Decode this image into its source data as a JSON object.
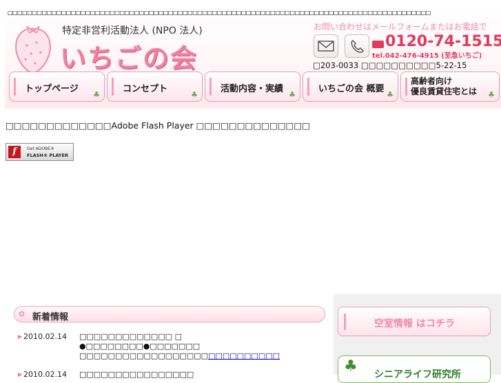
{
  "header": {
    "top_text": "□□□□□□□□□□□□□□□□□□□□□□□□□□□□□□□□□□□□□□□□□□□□□□□□□□□□□□□□□□□□□□□□□□□□□□□□□□□□□□□□□□□□□□□",
    "org_type": "特定非営利活動法人 (NPO 法人)",
    "org_name": "いちごの会",
    "contact_heading": "お問い合わせはメールフォームまたはお電話で",
    "tel_free": "0120-74-1515",
    "tel_sub": "tel.042-476-4915 (至急いちご)",
    "address": "□203-0033 □□□□□□□□□□5-22-15"
  },
  "nav": {
    "items": [
      {
        "label": "トップページ"
      },
      {
        "label": "コンセプト"
      },
      {
        "label": "活動内容・実績"
      },
      {
        "label": "いちごの会 概要"
      },
      {
        "label_line1": "高齢者向け",
        "label_line2": "優良賃貸住宅とは"
      }
    ]
  },
  "flash": {
    "message": "□□□□□□□□□□□□□Adobe Flash Player □□□□□□□□□□□□□□",
    "badge_line1": "Get ADOBE®",
    "badge_line2": "FLASH® PLAYER"
  },
  "news": {
    "title": "新着情報",
    "entries": [
      {
        "date": "2010.02.14",
        "line1": "□□□□□□□□□□□□□ □",
        "line2": "●□□□□□□□□●□□□□□□□",
        "line3_text": "□□□□□□□□□□□□□□□□□□",
        "line3_link": "□□□□□□□□□□"
      },
      {
        "date": "2010.02.14",
        "line1": "□□□□□□□□□□□□□□□□"
      }
    ]
  },
  "sidebar": {
    "vacancy_label": "空室情報 はコチラ",
    "senior_label": "シニアライフ研究所"
  },
  "colors": {
    "brand_pink": "#f27fa0",
    "tel_red": "#e03a5c",
    "clover_green": "#3f8f2f"
  }
}
